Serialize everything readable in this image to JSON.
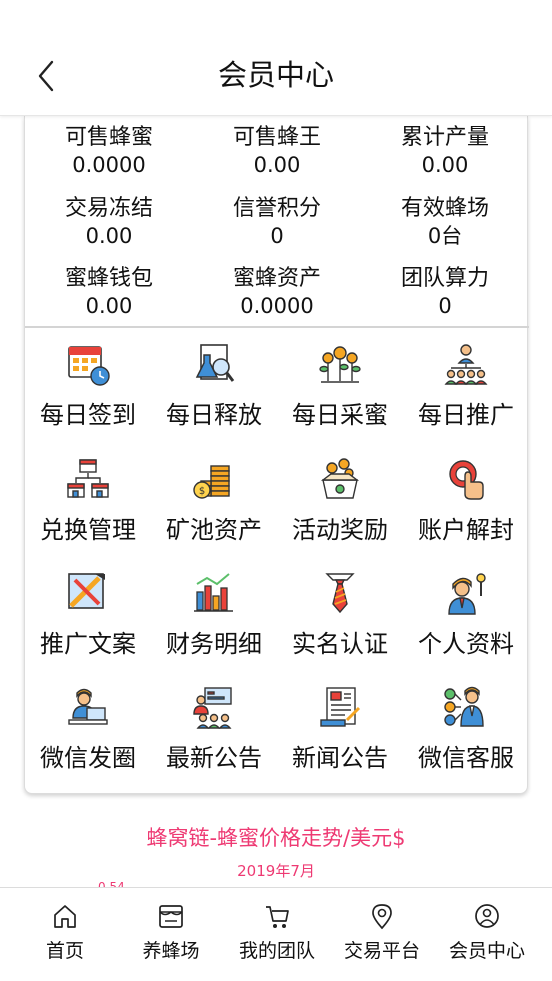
{
  "header": {
    "title": "会员中心",
    "back_icon": "chevron-left-icon"
  },
  "stats": [
    {
      "label": "可售蜂蜜",
      "value": "0.0000"
    },
    {
      "label": "可售蜂王",
      "value": "0.00"
    },
    {
      "label": "累计产量",
      "value": "0.00"
    },
    {
      "label": "交易冻结",
      "value": "0.00"
    },
    {
      "label": "信誉积分",
      "value": "0"
    },
    {
      "label": "有效蜂场",
      "value": "0台"
    },
    {
      "label": "蜜蜂钱包",
      "value": "0.00"
    },
    {
      "label": "蜜蜂资产",
      "value": "0.0000"
    },
    {
      "label": "团队算力",
      "value": "0"
    }
  ],
  "menu": [
    {
      "label": "每日签到",
      "icon": "calendar-clock-icon"
    },
    {
      "label": "每日释放",
      "icon": "lab-magnifier-icon"
    },
    {
      "label": "每日采蜜",
      "icon": "money-plants-icon"
    },
    {
      "label": "每日推广",
      "icon": "team-hierarchy-icon"
    },
    {
      "label": "兑换管理",
      "icon": "stores-network-icon"
    },
    {
      "label": "矿池资产",
      "icon": "coin-stacks-icon"
    },
    {
      "label": "活动奖励",
      "icon": "reward-box-icon"
    },
    {
      "label": "账户解封",
      "icon": "touch-button-icon"
    },
    {
      "label": "推广文案",
      "icon": "pencil-ruler-icon"
    },
    {
      "label": "财务明细",
      "icon": "bar-chart-icon"
    },
    {
      "label": "实名认证",
      "icon": "tie-icon"
    },
    {
      "label": "个人资料",
      "icon": "person-idea-icon"
    },
    {
      "label": "微信发圈",
      "icon": "person-laptop-icon"
    },
    {
      "label": "最新公告",
      "icon": "presentation-icon"
    },
    {
      "label": "新闻公告",
      "icon": "newspaper-icon"
    },
    {
      "label": "微信客服",
      "icon": "support-agent-icon"
    }
  ],
  "chart": {
    "title": "蜂窝链-蜂蜜价格走势/美元$",
    "subtitle": "2019年7月",
    "peek_value": "0.54"
  },
  "tabs": [
    {
      "label": "首页",
      "icon": "home-icon"
    },
    {
      "label": "养蜂场",
      "icon": "shop-icon"
    },
    {
      "label": "我的团队",
      "icon": "cart-icon"
    },
    {
      "label": "交易平台",
      "icon": "location-pin-icon"
    },
    {
      "label": "会员中心",
      "icon": "user-circle-icon"
    }
  ],
  "colors": {
    "accent": "#ee3a73",
    "icon_orange": "#f5a623",
    "icon_blue": "#3f8fd6",
    "icon_red": "#e8423a"
  }
}
